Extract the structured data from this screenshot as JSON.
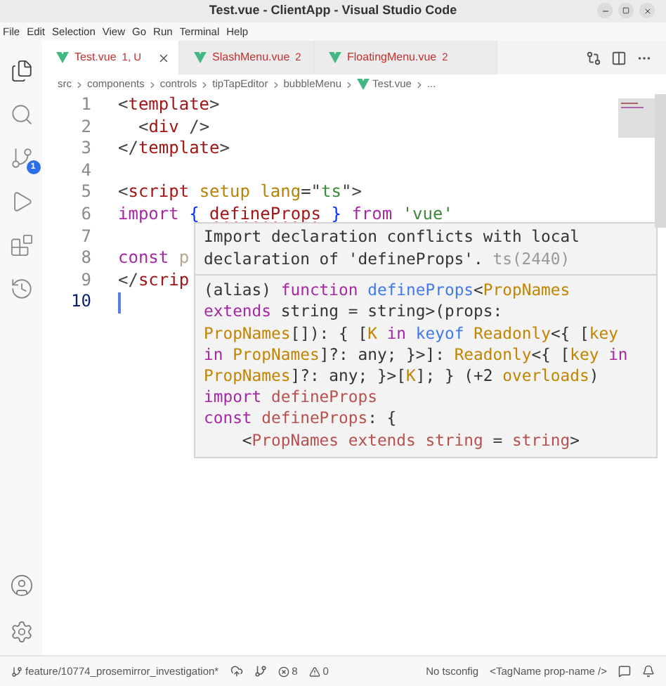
{
  "window": {
    "title": "Test.vue - ClientApp - Visual Studio Code"
  },
  "menu": [
    "File",
    "Edit",
    "Selection",
    "View",
    "Go",
    "Run",
    "Terminal",
    "Help"
  ],
  "activity_bar": [
    {
      "kind": "files",
      "selected": true
    },
    {
      "kind": "search",
      "selected": false
    },
    {
      "kind": "source-control",
      "selected": false,
      "badge": "1"
    },
    {
      "kind": "run",
      "selected": false
    },
    {
      "kind": "extensions",
      "selected": false
    },
    {
      "kind": "timeline",
      "selected": false
    }
  ],
  "activity_bottom": [
    {
      "kind": "account"
    },
    {
      "kind": "settings"
    }
  ],
  "tabs": [
    {
      "label": "Test.vue",
      "badge": "1, U",
      "selected": true
    },
    {
      "label": "SlashMenu.vue",
      "badge": "2",
      "selected": false
    },
    {
      "label": "FloatingMenu.vue",
      "badge": "2",
      "selected": false
    }
  ],
  "breadcrumb": [
    {
      "label": "src",
      "kind": "folder"
    },
    {
      "label": "components",
      "kind": "folder"
    },
    {
      "label": "controls",
      "kind": "folder"
    },
    {
      "label": "tipTapEditor",
      "kind": "folder"
    },
    {
      "label": "bubbleMenu",
      "kind": "folder"
    },
    {
      "label": "Test.vue",
      "kind": "file"
    },
    {
      "label": "...",
      "kind": "folder"
    }
  ],
  "editor": {
    "lines": [
      {
        "number": "1",
        "current": false,
        "tokens": [
          {
            "text": "<",
            "kind": "punct"
          },
          {
            "text": "template",
            "kind": "tag"
          },
          {
            "text": ">",
            "kind": "punct"
          }
        ]
      },
      {
        "number": "2",
        "current": false,
        "tokens": [
          {
            "text": "  <",
            "kind": "punct"
          },
          {
            "text": "div",
            "kind": "tag"
          },
          {
            "text": " />",
            "kind": "punct"
          }
        ]
      },
      {
        "number": "3",
        "current": false,
        "tokens": [
          {
            "text": "</",
            "kind": "punct"
          },
          {
            "text": "template",
            "kind": "tag"
          },
          {
            "text": ">",
            "kind": "punct"
          }
        ]
      },
      {
        "number": "4",
        "current": false
      },
      {
        "number": "5",
        "current": false,
        "tokens": [
          {
            "text": "<",
            "kind": "punct"
          },
          {
            "text": "script ",
            "kind": "tag"
          },
          {
            "text": "setup lang",
            "kind": "attr"
          },
          {
            "text": "=\"",
            "kind": "punct"
          },
          {
            "text": "ts",
            "kind": "string"
          },
          {
            "text": "\">",
            "kind": "punct"
          }
        ]
      },
      {
        "number": "6",
        "current": false,
        "tokens": [
          {
            "text": "import ",
            "kind": "keyword"
          },
          {
            "text": "{ ",
            "kind": "brace"
          },
          {
            "text": "defineProps",
            "kind": "error"
          },
          {
            "text": " }",
            "kind": "brace"
          },
          {
            "text": " from ",
            "kind": "keyword"
          },
          {
            "text": "'vue'",
            "kind": "string"
          }
        ]
      },
      {
        "number": "7",
        "current": false
      },
      {
        "number": "8",
        "current": false,
        "tokens": [
          {
            "text": "const ",
            "kind": "keyword"
          },
          {
            "text": "p",
            "kind": "faded"
          }
        ]
      },
      {
        "number": "9",
        "current": false,
        "tokens": [
          {
            "text": "</",
            "kind": "punct"
          },
          {
            "text": "scrip",
            "kind": "tag"
          }
        ]
      },
      {
        "number": "10",
        "current": true
      }
    ]
  },
  "hover": {
    "message": "Import declaration conflicts with local declaration of 'defineProps'.",
    "code": "ts(2440)",
    "signature": [
      [
        {
          "text": "(alias) ",
          "kind": "plain"
        },
        {
          "text": "function ",
          "kind": "keyword"
        },
        {
          "text": "defineProps",
          "kind": "func"
        },
        {
          "text": "<",
          "kind": "plain"
        },
        {
          "text": "PropNames",
          "kind": "type"
        }
      ],
      [
        {
          "text": "extends",
          "kind": "keyword"
        },
        {
          "text": " string = string>(props:",
          "kind": "plain"
        }
      ],
      [
        {
          "text": "PropNames",
          "kind": "type"
        },
        {
          "text": "[]): { [",
          "kind": "plain"
        },
        {
          "text": "K ",
          "kind": "type"
        },
        {
          "text": "in ",
          "kind": "keyword"
        },
        {
          "text": "keyof ",
          "kind": "func"
        },
        {
          "text": "Readonly",
          "kind": "type"
        },
        {
          "text": "<{ [",
          "kind": "plain"
        },
        {
          "text": "key",
          "kind": "type"
        }
      ],
      [
        {
          "text": "in ",
          "kind": "keyword"
        },
        {
          "text": "PropNames",
          "kind": "type"
        },
        {
          "text": "]?: any; }>]: ",
          "kind": "plain"
        },
        {
          "text": "Readonly",
          "kind": "type"
        },
        {
          "text": "<{ [",
          "kind": "plain"
        },
        {
          "text": "key ",
          "kind": "type"
        },
        {
          "text": "in",
          "kind": "keyword"
        }
      ],
      [
        {
          "text": "PropNames",
          "kind": "type"
        },
        {
          "text": "]?: any; }>[",
          "kind": "plain"
        },
        {
          "text": "K",
          "kind": "type"
        },
        {
          "text": "]; } (+2 ",
          "kind": "plain"
        },
        {
          "text": "overloads",
          "kind": "type"
        },
        {
          "text": ")",
          "kind": "plain"
        }
      ],
      [
        {
          "text": "import ",
          "kind": "keyword"
        },
        {
          "text": "defineProps",
          "kind": "var"
        }
      ],
      [
        {
          "text": "const ",
          "kind": "keyword"
        },
        {
          "text": "defineProps",
          "kind": "var"
        },
        {
          "text": ": {",
          "kind": "plain"
        }
      ],
      [
        {
          "text": "    <",
          "kind": "plain"
        },
        {
          "text": "PropNames extends string",
          "kind": "var"
        },
        {
          "text": " = ",
          "kind": "plain"
        },
        {
          "text": "string",
          "kind": "var"
        },
        {
          "text": ">",
          "kind": "plain"
        }
      ]
    ]
  },
  "status_bar": {
    "branch": "feature/10774_prosemirror_investigation*",
    "errors": "8",
    "warnings": "0",
    "items": [
      "No tsconfig",
      "<TagName prop-name />"
    ]
  }
}
